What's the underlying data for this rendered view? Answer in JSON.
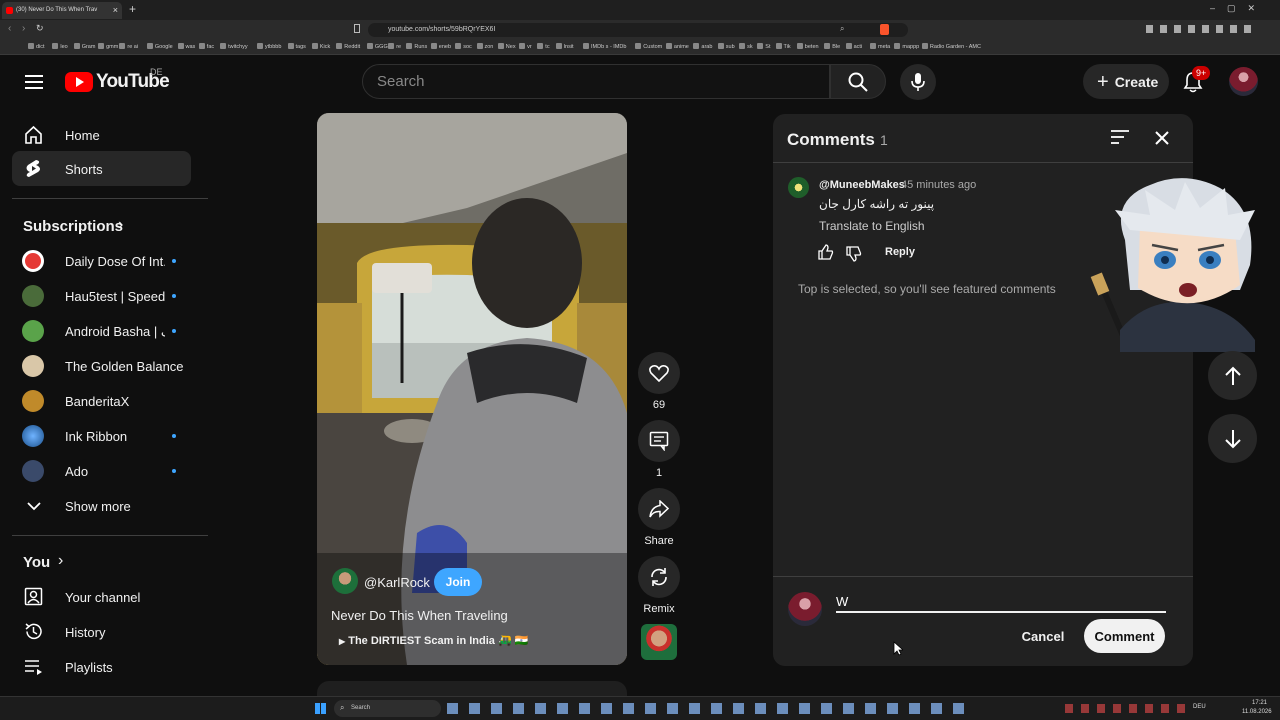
{
  "browser": {
    "tab_title": "(30) Never Do This When Trav",
    "url": "youtube.com/shorts/59bRQrYEX6I",
    "bookmarks": [
      "dict",
      "leo",
      "Gram",
      "gmm",
      "re ai",
      "Google",
      "was",
      "fac",
      "twitchyy",
      "ytbbbb",
      "tags",
      "Kick",
      "Reddit",
      "GGG",
      "re",
      "Runs",
      "eneb",
      "soc",
      "zon",
      "Nex",
      "vr",
      "tc",
      "Insit",
      "IMDb s - IMDb",
      "Custom",
      "anime",
      "arab",
      "sub",
      "sk",
      "St",
      "Tik",
      "beten",
      "Ble",
      "acti",
      "meta",
      "mappp",
      "Radio Garden - AMC"
    ]
  },
  "header": {
    "logo_text": "YouTube",
    "country_code": "DE",
    "search_placeholder": "Search",
    "create_label": "Create",
    "notifications_badge": "9+"
  },
  "sidebar": {
    "nav": [
      {
        "label": "Home",
        "icon": "home-icon"
      },
      {
        "label": "Shorts",
        "icon": "shorts-icon"
      }
    ],
    "subscriptions_title": "Subscriptions",
    "subscriptions": [
      {
        "label": "Daily Dose Of Int...",
        "dot": true,
        "color": "#e53935"
      },
      {
        "label": "Hau5test | Speed...",
        "dot": true,
        "color": "#4a6b3a"
      },
      {
        "label": "Android Basha | ک...",
        "dot": true,
        "color": "#5aa34a"
      },
      {
        "label": "The Golden Balance",
        "dot": false,
        "color": "#d9c7a8"
      },
      {
        "label": "BanderitaX",
        "dot": false,
        "color": "#c08a2a"
      },
      {
        "label": "Ink Ribbon",
        "dot": true,
        "color": "#2a6fb0"
      },
      {
        "label": "Ado",
        "dot": true,
        "color": "#3a4a6a"
      }
    ],
    "show_more": "Show more",
    "you_title": "You",
    "you_items": [
      {
        "label": "Your channel",
        "icon": "channel-icon"
      },
      {
        "label": "History",
        "icon": "history-icon"
      },
      {
        "label": "Playlists",
        "icon": "playlists-icon"
      }
    ]
  },
  "short": {
    "channel": "@KarlRock",
    "join_label": "Join",
    "title": "Never Do This When Traveling",
    "linked_video": "The DIRTIEST Scam in India 🛺 🇮🇳"
  },
  "actions": {
    "likes": "69",
    "comments": "1",
    "share": "Share",
    "remix": "Remix"
  },
  "comments": {
    "title": "Comments",
    "count": "1",
    "items": [
      {
        "author": "@MuneebMakes",
        "time": "45 minutes ago",
        "text": "پینور تە راشە کارل جان",
        "translate": "Translate to English",
        "reply": "Reply"
      }
    ],
    "featured_note": "Top is selected, so you'll see featured comments",
    "input_value": "W",
    "cancel_label": "Cancel",
    "comment_label": "Comment"
  },
  "taskbar": {
    "search_placeholder": "Search",
    "language": "DEU",
    "time": "17:21",
    "date": "11.08.2026"
  }
}
